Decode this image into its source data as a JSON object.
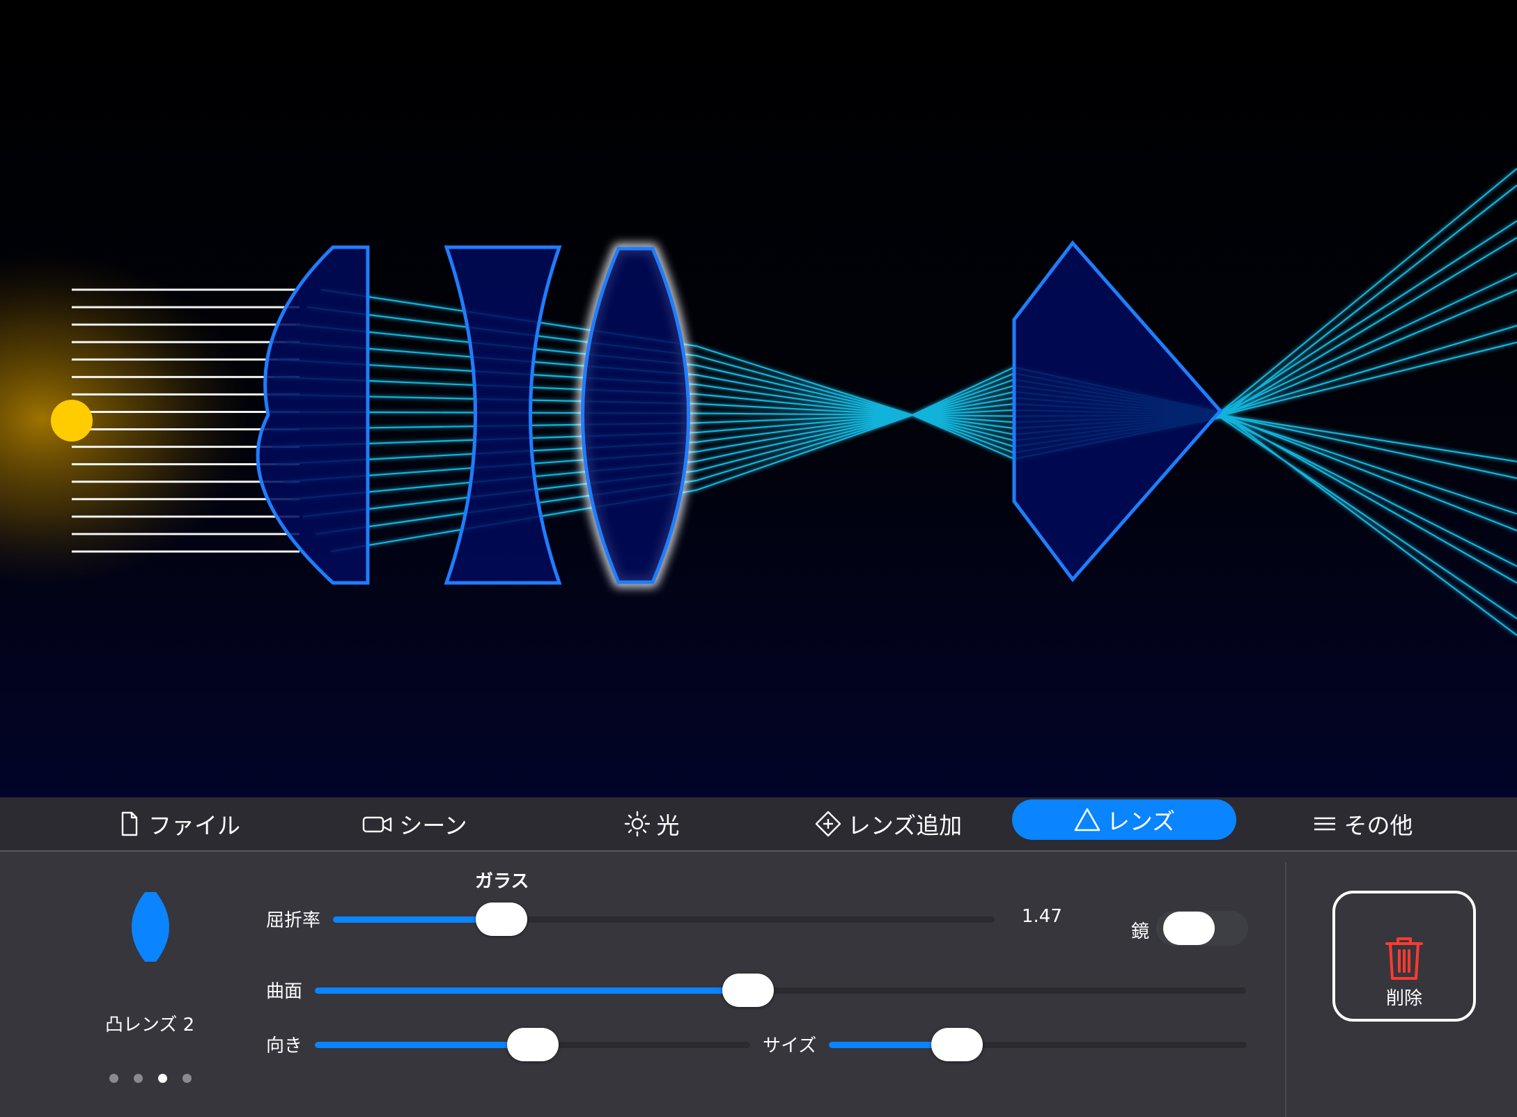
{
  "tabs": [
    {
      "label": "ファイル",
      "icon": "file-icon"
    },
    {
      "label": "シーン",
      "icon": "camera-icon"
    },
    {
      "label": "光",
      "icon": "sun-icon"
    },
    {
      "label": "レンズ追加",
      "icon": "add-lens-icon"
    },
    {
      "label": "レンズ",
      "icon": "triangle-icon",
      "active": true
    },
    {
      "label": "その他",
      "icon": "menu-icon"
    }
  ],
  "panel": {
    "lens_name": "凸レンズ 2",
    "lens_icon": "convex-lens-icon",
    "material_label": "ガラス",
    "refractive_index": {
      "label": "屈折率",
      "value_text": "1.47",
      "position": 0.25
    },
    "mirror": {
      "label": "鏡",
      "on": false
    },
    "curvature": {
      "label": "曲面",
      "position": 0.465
    },
    "orientation": {
      "label": "向き",
      "position": 0.44
    },
    "size": {
      "label": "サイズ",
      "position": 0.31
    },
    "page_indicator": {
      "count": 4,
      "current": 3
    },
    "delete_label": "削除"
  },
  "colors": {
    "accent": "#0a84ff",
    "lens_fill": "#000a5c",
    "lens_stroke": "#1f7dff",
    "ray": "#19d3ff",
    "light_source": "#ffcc00",
    "delete_icon": "#ff3b30"
  }
}
